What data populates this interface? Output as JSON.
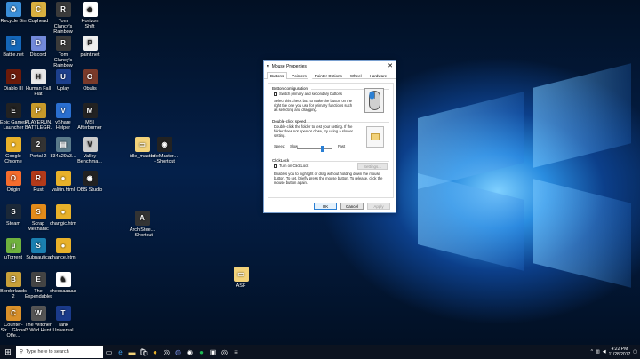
{
  "desktop_icons": [
    {
      "label": "Recycle Bin",
      "icon": "recycle-bin-icon",
      "color": "#3a8ed8",
      "glyph": "♻"
    },
    {
      "label": "Battle.net",
      "icon": "battlenet-icon",
      "color": "#1466b8",
      "glyph": "B"
    },
    {
      "label": "Diablo III",
      "icon": "diablo-icon",
      "color": "#6b1a0a",
      "glyph": "D"
    },
    {
      "label": "Epic Games Launcher",
      "icon": "epic-icon",
      "color": "#222",
      "glyph": "E"
    },
    {
      "label": "Google Chrome",
      "icon": "chrome-icon",
      "color": "#e8b12a",
      "glyph": "●"
    },
    {
      "label": "Origin",
      "icon": "origin-icon",
      "color": "#f56c2d",
      "glyph": "O"
    },
    {
      "label": "Steam",
      "icon": "steam-icon",
      "color": "#1b2838",
      "glyph": "S"
    },
    {
      "label": "uTorrent",
      "icon": "utorrent-icon",
      "color": "#6fb13e",
      "glyph": "µ"
    },
    {
      "label": "Borderlands 2",
      "icon": "borderlands-icon",
      "color": "#c8a03a",
      "glyph": "B"
    },
    {
      "label": "Counter-Str... Global Offe...",
      "icon": "csgo-icon",
      "color": "#d9902a",
      "glyph": "C"
    },
    {
      "label": "Cuphead",
      "icon": "cuphead-icon",
      "color": "#d9b040",
      "glyph": "C"
    },
    {
      "label": "Discord",
      "icon": "discord-icon",
      "color": "#7289da",
      "glyph": "D"
    },
    {
      "label": "Human Fall Flat",
      "icon": "humanfallflat-icon",
      "color": "#e8e8e8",
      "glyph": "H"
    },
    {
      "label": "PLAYERUN... BATTLEGR...",
      "icon": "pubg-icon",
      "color": "#c79a2a",
      "glyph": "P"
    },
    {
      "label": "Portal 2",
      "icon": "portal-icon",
      "color": "#333",
      "glyph": "2"
    },
    {
      "label": "Rust",
      "icon": "rust-icon",
      "color": "#b33a1a",
      "glyph": "R"
    },
    {
      "label": "Scrap Mechanic",
      "icon": "scrap-icon",
      "color": "#e38b1a",
      "glyph": "S"
    },
    {
      "label": "Subnautica",
      "icon": "subnautica-icon",
      "color": "#1a7fb0",
      "glyph": "S"
    },
    {
      "label": "The Expendables",
      "icon": "expendables-icon",
      "color": "#444",
      "glyph": "E"
    },
    {
      "label": "The Witcher 3 Wild Hunt",
      "icon": "witcher-icon",
      "color": "#555",
      "glyph": "W"
    },
    {
      "label": "Tom Clancy's Rainbow Si...",
      "icon": "rainbow-icon",
      "color": "#3a3a3a",
      "glyph": "R"
    },
    {
      "label": "Tom Clancy's Rainbow Si...",
      "icon": "rainbow2-icon",
      "color": "#3a3a3a",
      "glyph": "R"
    },
    {
      "label": "Uplay",
      "icon": "uplay-icon",
      "color": "#1c3f8c",
      "glyph": "U"
    },
    {
      "label": "vShare Helper",
      "icon": "vshare-icon",
      "color": "#2a6fd0",
      "glyph": "V"
    },
    {
      "label": "834a29a3...",
      "icon": "file-icon",
      "color": "#5a7a8a",
      "glyph": "▤"
    },
    {
      "label": "valitin.html",
      "icon": "chrome-html-icon",
      "color": "#e8b12a",
      "glyph": "●"
    },
    {
      "label": "changic.html",
      "icon": "chrome-html2-icon",
      "color": "#e8b12a",
      "glyph": "●"
    },
    {
      "label": "chance.html",
      "icon": "chrome-html3-icon",
      "color": "#e8b12a",
      "glyph": "●"
    },
    {
      "label": "chessaaaaa...",
      "icon": "chess-icon",
      "color": "#fff",
      "glyph": "♞"
    },
    {
      "label": "Tank Universal",
      "icon": "tank-icon",
      "color": "#1a3a8a",
      "glyph": "T"
    },
    {
      "label": "Horizon Shift",
      "icon": "horizon-icon",
      "color": "#fff",
      "glyph": "◆"
    },
    {
      "label": "paint.net",
      "icon": "paintnet-icon",
      "color": "#eee",
      "glyph": "P"
    },
    {
      "label": "Obulis",
      "icon": "obulis-icon",
      "color": "#7a3a2a",
      "glyph": "O"
    },
    {
      "label": "MSI Afterburner",
      "icon": "msi-icon",
      "color": "#222",
      "glyph": "M"
    },
    {
      "label": "Valley Benchma...",
      "icon": "valley-icon",
      "color": "#ccc",
      "glyph": "V"
    },
    {
      "label": "OBS Studio",
      "icon": "obs-icon",
      "color": "#222",
      "glyph": "◉"
    },
    {
      "label": "idle_master",
      "icon": "folder-icon",
      "color": "#f2d27a",
      "glyph": "▭"
    },
    {
      "label": "IdleMaster... - Shortcut",
      "icon": "idlemaster-icon",
      "color": "#222",
      "glyph": "◉"
    },
    {
      "label": "ArchiStee... - Shortcut",
      "icon": "archisteam-icon",
      "color": "#333",
      "glyph": "A"
    },
    {
      "label": "ASF",
      "icon": "asf-folder-icon",
      "color": "#f2d27a",
      "glyph": "▭"
    }
  ],
  "dialog": {
    "title": "Mouse Properties",
    "close": "✕",
    "tabs": [
      "Buttons",
      "Pointers",
      "Pointer Options",
      "Wheel",
      "Hardware"
    ],
    "button_config": {
      "header": "Button configuration",
      "checkbox_label": "Switch primary and secondary buttons",
      "description": "Select this check box to make the button on the right the one you use for primary functions such as selecting and dragging."
    },
    "double_click": {
      "header": "Double-click speed",
      "description": "Double-click the folder to test your setting. If the folder does not open or close, try using a slower setting.",
      "speed_label": "Speed:",
      "slow": "Slow",
      "fast": "Fast",
      "speed_level": 0.7
    },
    "clicklock": {
      "header": "ClickLock",
      "checkbox_label": "Turn on ClickLock",
      "settings_button": "Settings...",
      "description": "Enables you to highlight or drag without holding down the mouse button. To set, briefly press the mouse button. To release, click the mouse button again."
    },
    "buttons": {
      "ok": "OK",
      "cancel": "Cancel",
      "apply": "Apply"
    }
  },
  "taskbar": {
    "search_placeholder": "Type here to search",
    "time": "4:22 PM",
    "date": "11/28/2017"
  }
}
